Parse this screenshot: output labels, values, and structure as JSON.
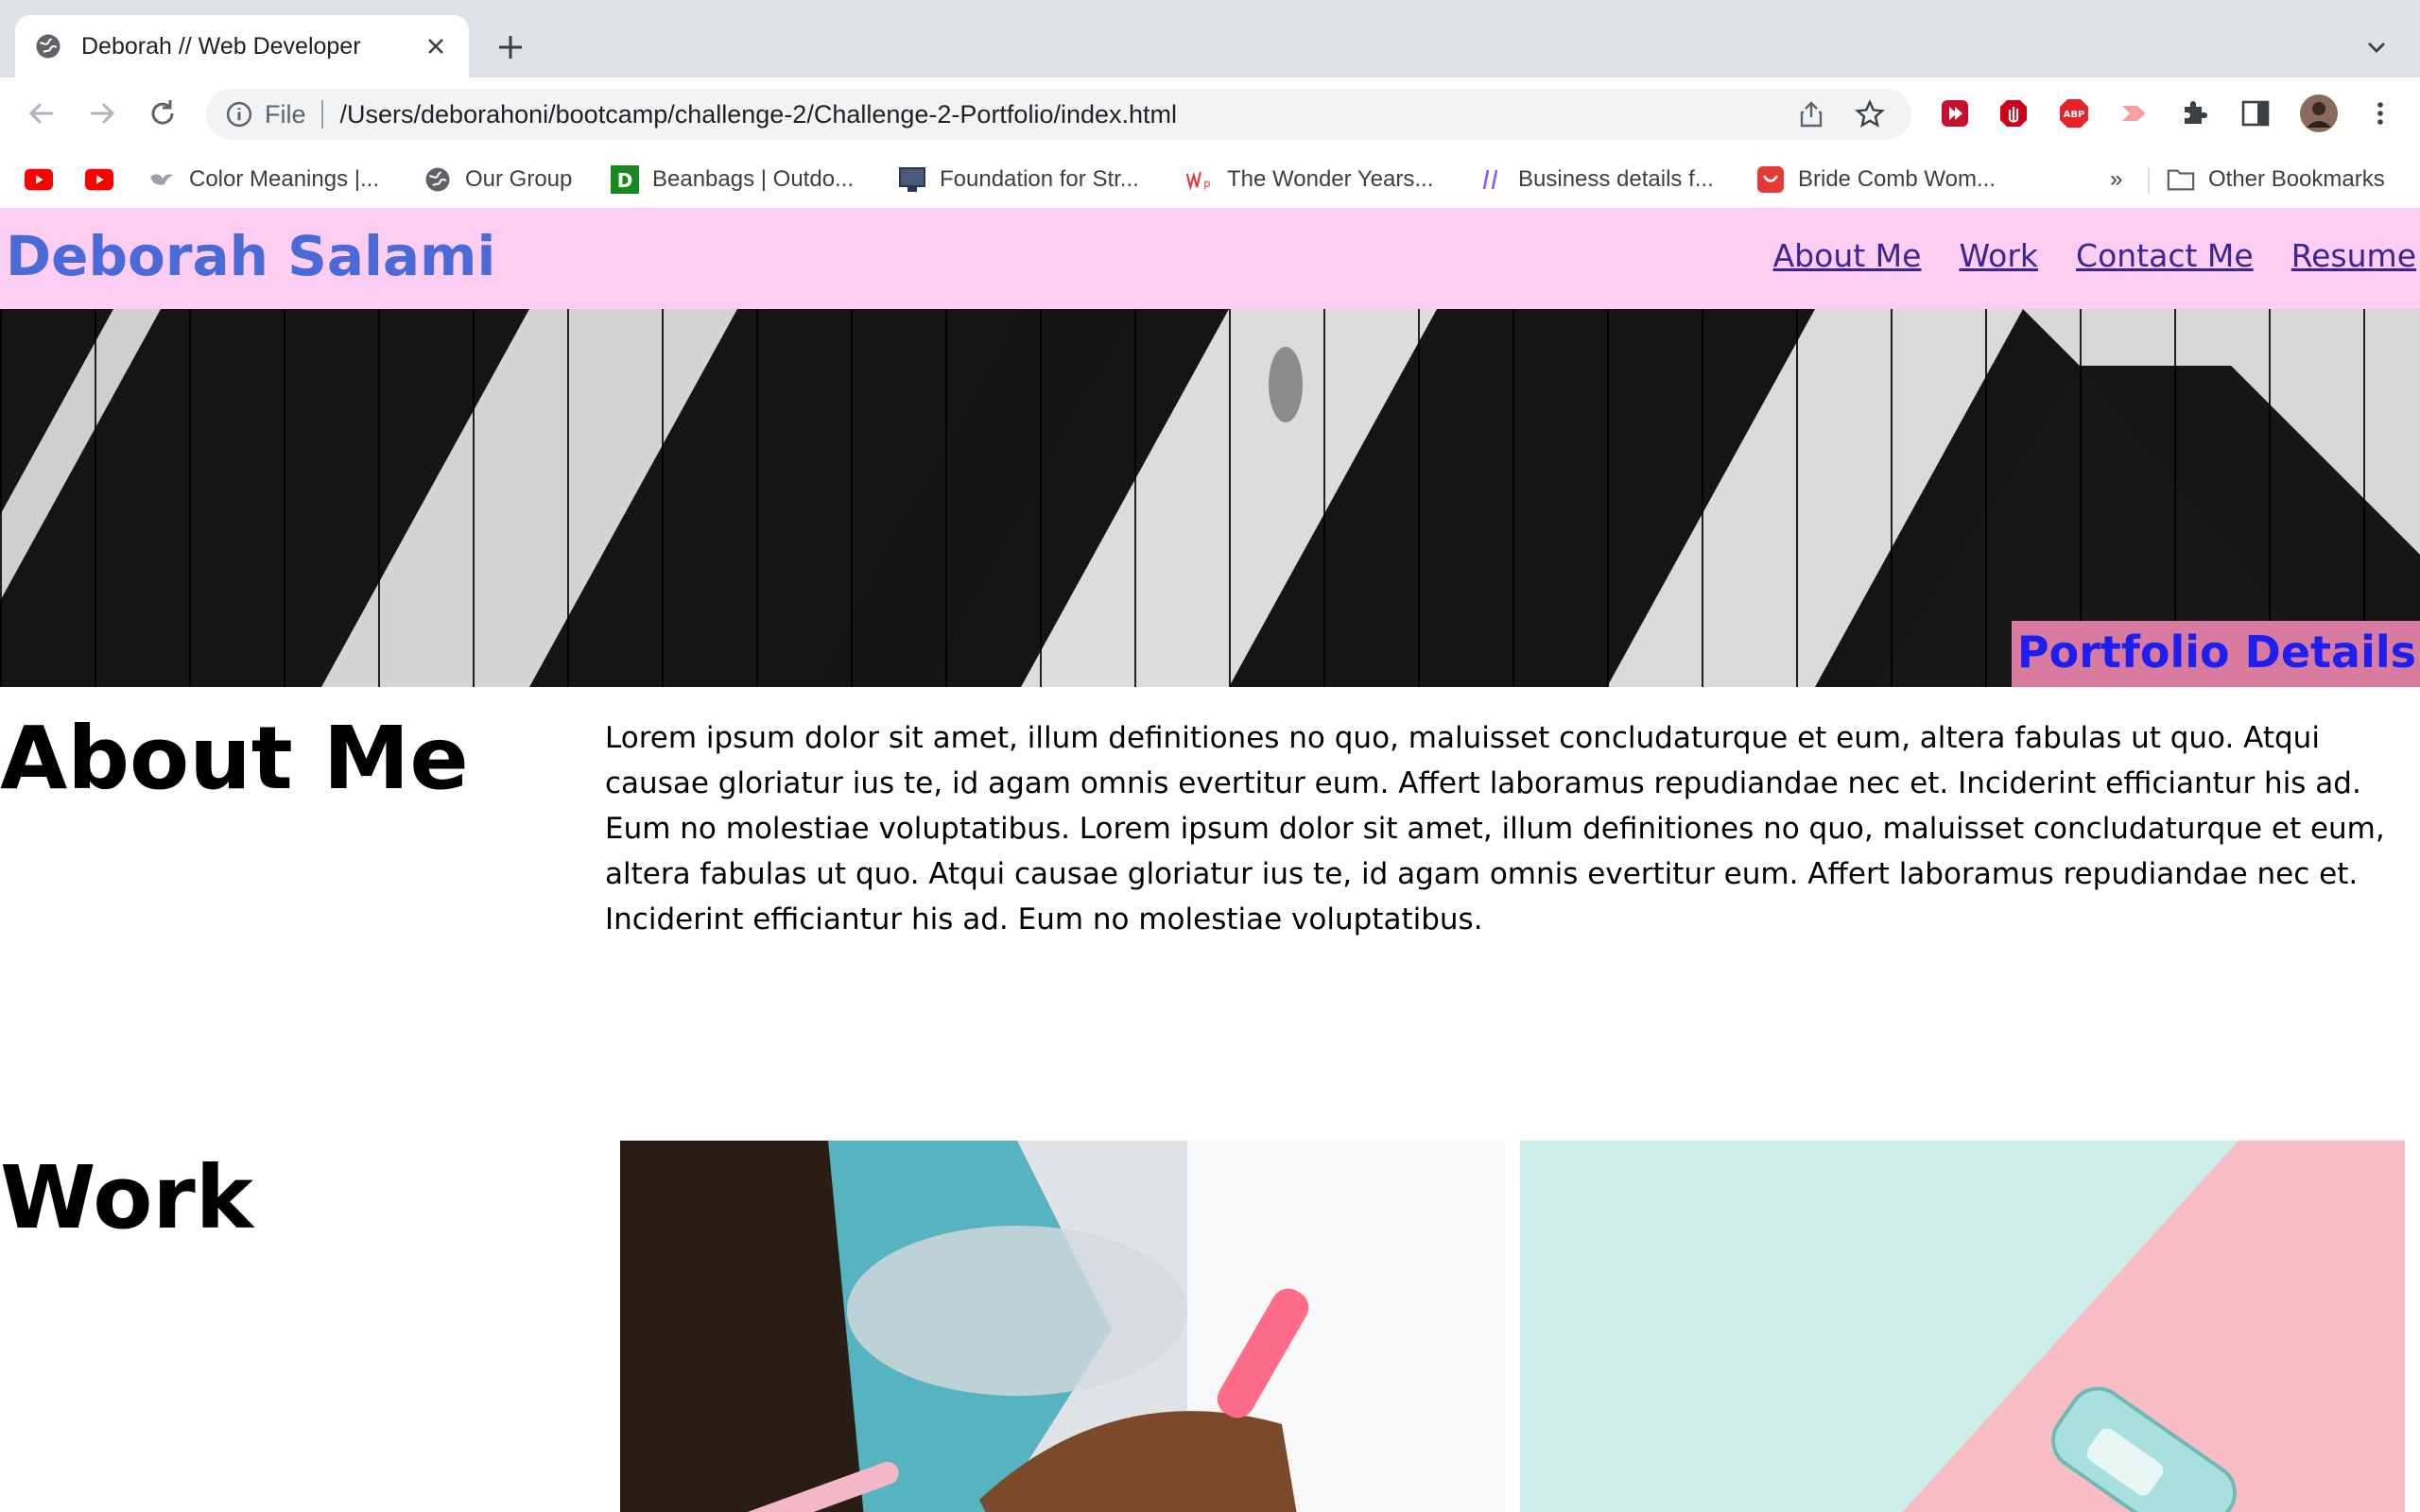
{
  "browser": {
    "tab_title": "Deborah // Web Developer",
    "address_scheme": "File",
    "address_url": "/Users/deborahoni/bootcamp/challenge-2/Challenge-2-Portfolio/index.html",
    "bookmarks": [
      {
        "label": "",
        "icon": "youtube-icon"
      },
      {
        "label": "",
        "icon": "youtube-icon"
      },
      {
        "label": "Color Meanings |...",
        "icon": "bird-icon"
      },
      {
        "label": "Our Group",
        "icon": "globe-icon"
      },
      {
        "label": "Beanbags | Outdo...",
        "icon": "d-logo-icon"
      },
      {
        "label": "Foundation for Str...",
        "icon": "monitor-icon"
      },
      {
        "label": "The Wonder Years...",
        "icon": "wp-logo-icon"
      },
      {
        "label": "Business details f...",
        "icon": "hash-icon"
      },
      {
        "label": "Bride Comb Wom...",
        "icon": "shop-icon"
      }
    ],
    "overflow_label": "»",
    "other_bookmarks_label": "Other Bookmarks"
  },
  "site": {
    "title": "Deborah Salami",
    "nav": [
      "About Me",
      "Work",
      "Contact Me",
      "Resume"
    ],
    "hero_badge": "Portfolio Details",
    "about_heading": "About Me",
    "about_text": "Lorem ipsum dolor sit amet, illum definitiones no quo, maluisset concludaturque et eum, altera fabulas ut quo. Atqui causae gloriatur ius te, id agam omnis evertitur eum. Affert laboramus repudiandae nec et. Inciderint efficiantur his ad. Eum no molestiae voluptatibus. Lorem ipsum dolor sit amet, illum definitiones no quo, maluisset concludaturque et eum, altera fabulas ut quo. Atqui causae gloriatur ius te, id agam omnis evertitur eum. Affert laboramus repudiandae nec et. Inciderint efficiantur his ad. Eum no molestiae voluptatibus.",
    "work_heading": "Work"
  },
  "colors": {
    "header_bg": "#fecdf3",
    "title": "#4a6ad8",
    "nav_link": "#3a2594",
    "badge_bg": "#d97a9f",
    "badge_text": "#1d1ef0"
  }
}
